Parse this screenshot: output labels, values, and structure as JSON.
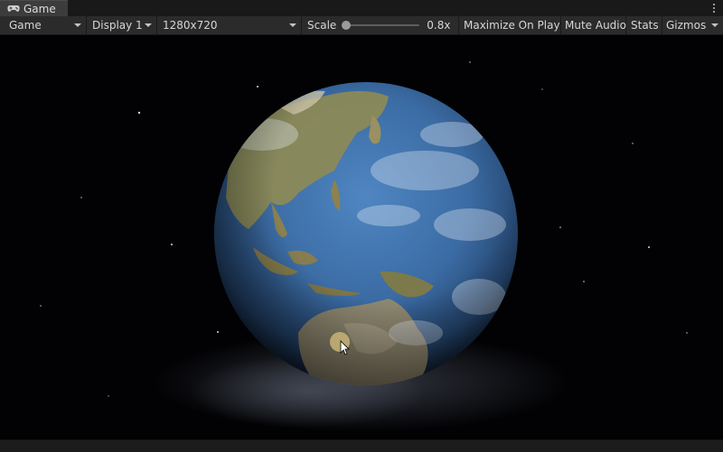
{
  "window": {
    "tab_label": "Game",
    "tab_icon": "gamepad-icon",
    "menu_icon": "kebab-menu-icon"
  },
  "toolbar": {
    "view_dropdown": "Game",
    "display_dropdown": "Display 1",
    "resolution_dropdown": "1280x720",
    "scale_label": "Scale",
    "scale_value": "0.8x",
    "scale_fraction": 0.03,
    "maximize_label": "Maximize On Play",
    "mute_label": "Mute Audio",
    "stats_label": "Stats",
    "gizmos_label": "Gizmos"
  },
  "colors": {
    "editor_dark": "#1e1e1e",
    "toolbar": "#2b2b2b",
    "space": "#020204",
    "ocean": "#3c6ea6",
    "land": "#8a8550",
    "cursor_highlight": "#c8b478"
  }
}
